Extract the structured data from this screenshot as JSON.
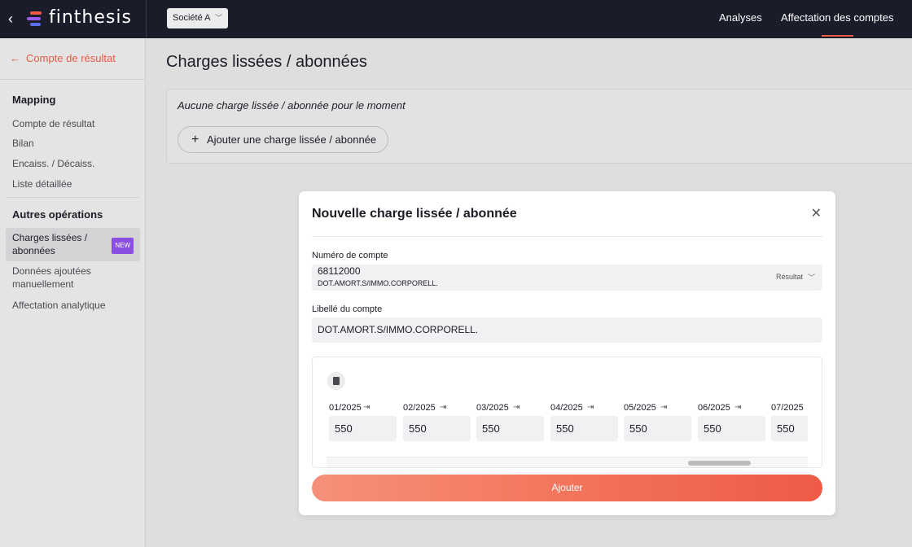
{
  "topbar": {
    "brand": "finthesis",
    "company_selector": "Société A",
    "nav": [
      {
        "label": "Analyses"
      },
      {
        "label": "Affectation des comptes"
      }
    ]
  },
  "sidebar": {
    "back_label": "Compte de résultat",
    "sections": [
      {
        "title": "Mapping",
        "items": [
          "Compte de résultat",
          "Bilan",
          "Encaiss. / Décaiss.",
          "Liste détaillée"
        ]
      },
      {
        "title": "Autres opérations",
        "items": [
          "Charges lissées / abonnées",
          "Données ajoutées manuellement",
          "Affectation analytique"
        ]
      }
    ],
    "badge": "NEW"
  },
  "main": {
    "title": "Charges lissées / abonnées",
    "empty_message": "Aucune charge lissée / abonnée pour le moment",
    "add_button": "Ajouter une charge lissée / abonnée"
  },
  "modal": {
    "title": "Nouvelle charge lissée / abonnée",
    "account_label": "Numéro de compte",
    "account_number": "68112000",
    "account_description": "DOT.AMORT.S/IMMO.CORPORELL.",
    "account_type": "Résultat",
    "libelle_label": "Libellé du compte",
    "libelle_value": "DOT.AMORT.S/IMMO.CORPORELL.",
    "months": [
      {
        "label": "01/2025",
        "value": "550"
      },
      {
        "label": "02/2025",
        "value": "550"
      },
      {
        "label": "03/2025",
        "value": "550"
      },
      {
        "label": "04/2025",
        "value": "550"
      },
      {
        "label": "05/2025",
        "value": "550"
      },
      {
        "label": "06/2025",
        "value": "550"
      },
      {
        "label": "07/2025",
        "value": "550"
      }
    ],
    "submit_label": "Ajouter"
  },
  "colors": {
    "accent": "#ec5a43",
    "topbar_bg": "#1b1c2a",
    "badge": "#8a4fe0"
  }
}
